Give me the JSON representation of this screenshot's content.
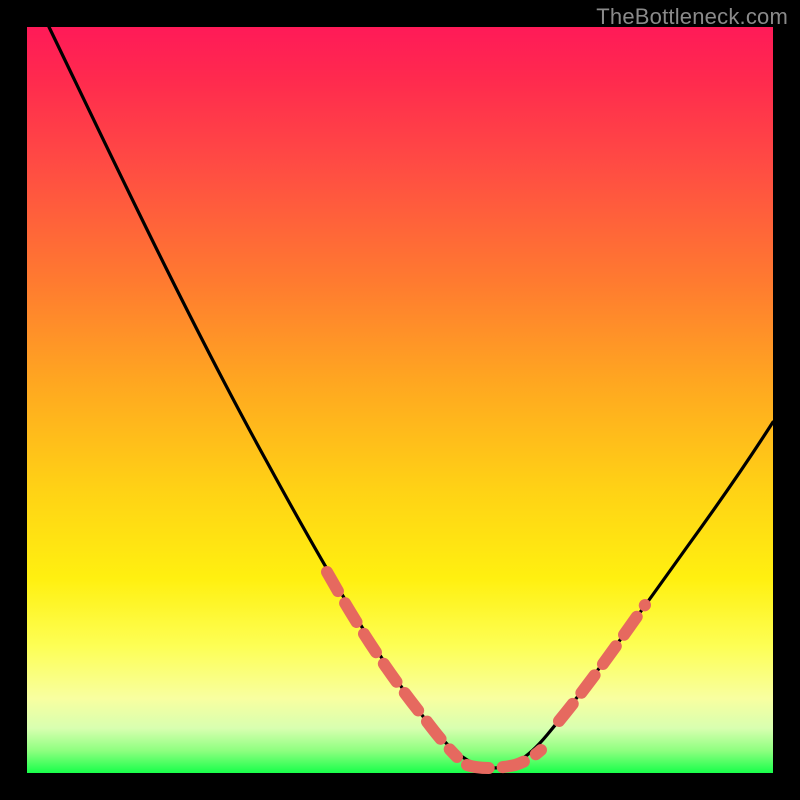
{
  "attribution": "TheBottleneck.com",
  "colors": {
    "background": "#000000",
    "gradient_top": "#ff1a58",
    "gradient_mid": "#ffd215",
    "gradient_bottom": "#18ff4a",
    "curve": "#000000",
    "highlight": "#e6695f"
  },
  "chart_data": {
    "type": "line",
    "title": "",
    "xlabel": "",
    "ylabel": "",
    "xlim": [
      0,
      100
    ],
    "ylim": [
      0,
      100
    ],
    "grid": false,
    "series": [
      {
        "name": "bottleneck-curve",
        "x": [
          3,
          10,
          20,
          30,
          40,
          45,
          50,
          55,
          58,
          60,
          63,
          65,
          68,
          72,
          78,
          85,
          92,
          100
        ],
        "y": [
          100,
          85,
          65,
          46,
          28,
          20,
          13,
          6,
          2,
          0.5,
          0.5,
          1,
          3,
          8,
          17,
          27,
          38,
          50
        ]
      }
    ],
    "highlight_segments": [
      {
        "x": [
          40,
          57
        ],
        "note": "left descending arm highlight"
      },
      {
        "x": [
          59,
          67
        ],
        "note": "valley floor highlight"
      },
      {
        "x": [
          71,
          82
        ],
        "note": "right ascending arm highlight"
      }
    ]
  }
}
